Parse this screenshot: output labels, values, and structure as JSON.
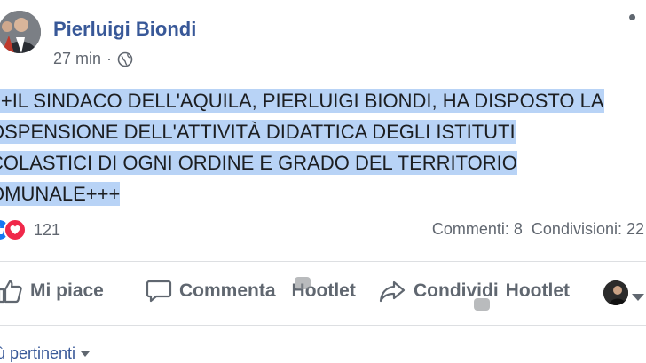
{
  "author": {
    "name": "Pierluigi Biondi"
  },
  "meta": {
    "time": "27 min",
    "separator": "·",
    "audience_icon": "globe-icon"
  },
  "post": {
    "lines": [
      "++IL SINDACO DELL'AQUILA, PIERLUIGI BIONDI, HA DISPOSTO LA",
      "OSPENSIONE DELL'ATTIVITÀ DIDATTICA DEGLI ISTITUTI",
      "COLASTICI DI OGNI ORDINE E GRADO DEL TERRITORIO",
      "OMUNALE+++"
    ],
    "highlight_color": "#b8d3f6"
  },
  "reactions": {
    "count": "121",
    "icons": [
      "like-icon",
      "love-icon"
    ]
  },
  "stats": {
    "comments": "Commenti: 8",
    "shares": "Condivisioni: 22"
  },
  "actions": {
    "like": "Mi piace",
    "comment": "Commenta",
    "hootlet1": "Hootlet",
    "share": "Condividi",
    "hootlet2": "Hootlet"
  },
  "sort": {
    "label": "ù pertinenti"
  },
  "colors": {
    "link": "#385898",
    "muted": "#606770",
    "like": "#1877f2",
    "love": "#f0284a"
  }
}
